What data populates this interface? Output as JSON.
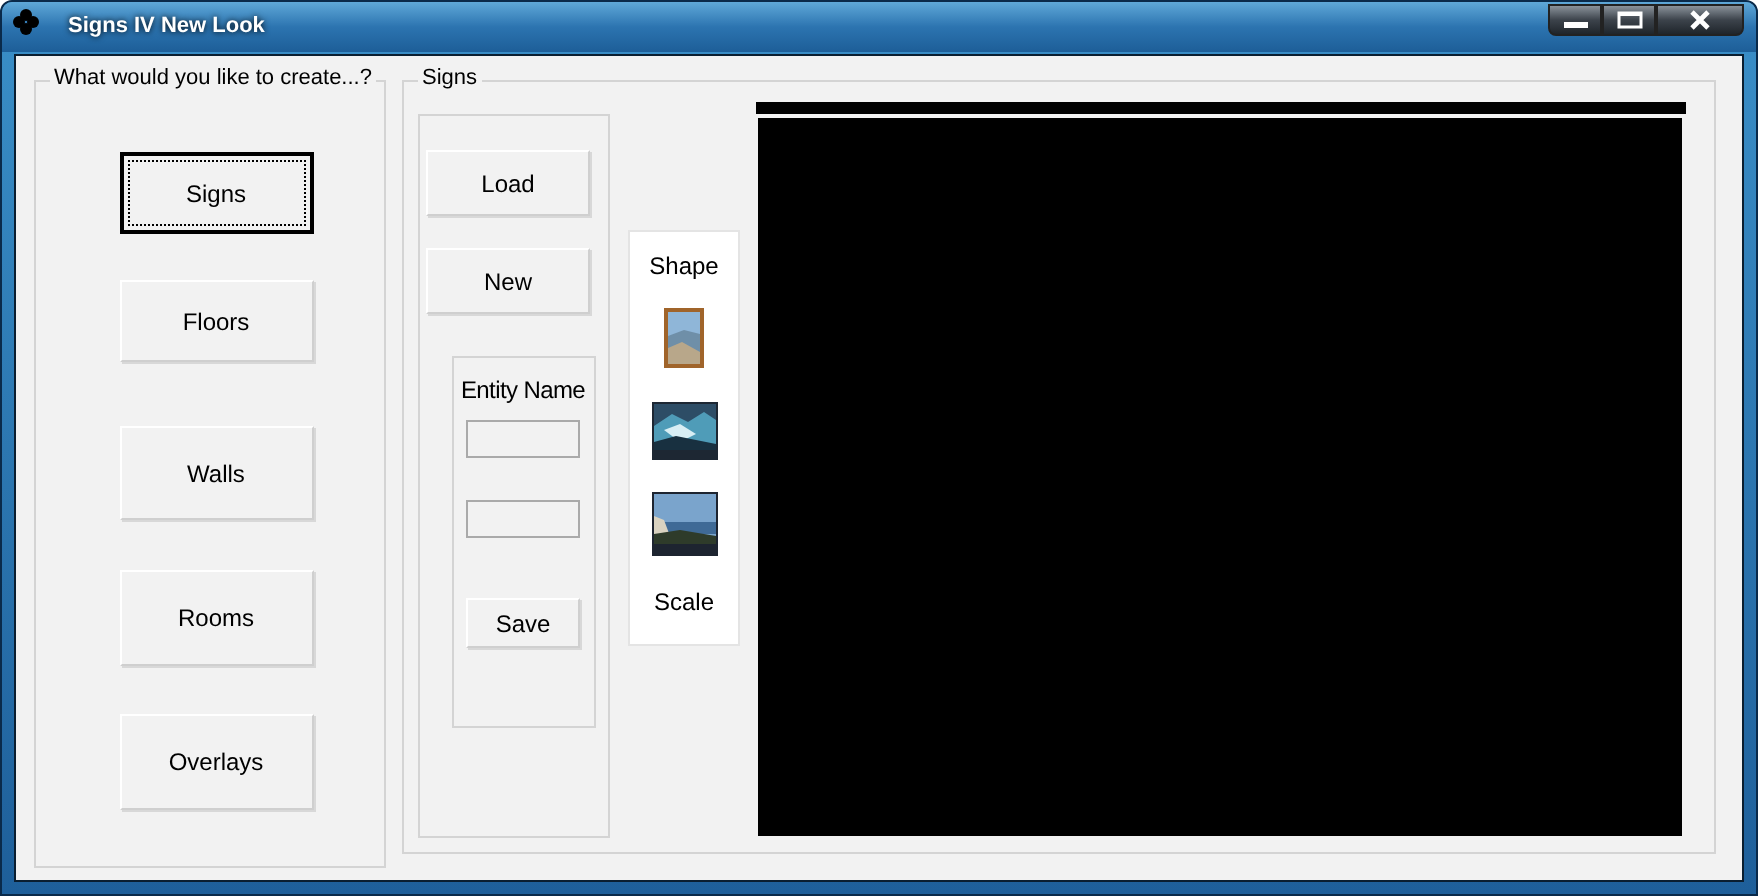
{
  "window": {
    "title": "Signs IV New Look"
  },
  "create_group": {
    "legend": "What would you like to create...?",
    "buttons": [
      {
        "label": "Signs",
        "selected": true
      },
      {
        "label": "Floors",
        "selected": false
      },
      {
        "label": "Walls",
        "selected": false
      },
      {
        "label": "Rooms",
        "selected": false
      },
      {
        "label": "Overlays",
        "selected": false
      }
    ]
  },
  "signs_group": {
    "legend": "Signs",
    "load_button": "Load",
    "new_button": "New",
    "entity_label": "Entity Name",
    "save_button": "Save",
    "shape_label": "Shape",
    "scale_label": "Scale"
  }
}
